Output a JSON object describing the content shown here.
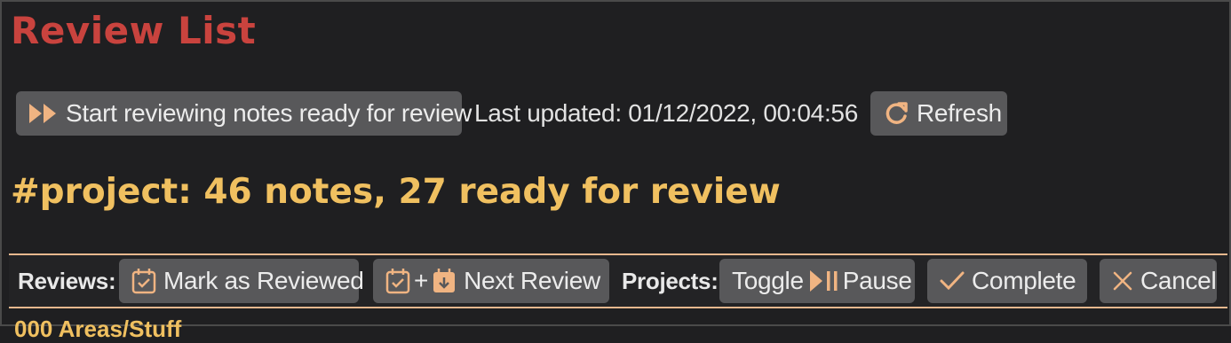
{
  "title": "Review List",
  "start_button": {
    "label": "Start reviewing notes ready for review",
    "icon": "fast-forward-icon"
  },
  "last_updated": "Last updated: 01/12/2022, 00:04:56",
  "refresh_button": {
    "label": "Refresh",
    "icon": "refresh-icon"
  },
  "heading": "#project: 46 notes, 27 ready for review",
  "toolbar": {
    "reviews_label": "Reviews:",
    "mark_reviewed": {
      "label": "Mark as Reviewed",
      "icon": "calendar-check-icon"
    },
    "next_review": {
      "plus": "+",
      "label": "Next Review",
      "icons": [
        "calendar-check-icon",
        "calendar-download-icon"
      ]
    },
    "projects_label": "Projects:",
    "toggle_pause": {
      "label_before": "Toggle",
      "label_after": "Pause",
      "icon": "play-pause-icon"
    },
    "complete": {
      "label": "Complete",
      "icon": "check-icon"
    },
    "cancel": {
      "label": "Cancel",
      "icon": "close-icon"
    }
  },
  "below_text": "000 Areas/Stuff",
  "colors": {
    "title": "#c9433e",
    "heading": "#f0c060",
    "icon": "#f0b482",
    "button_bg": "#58585a",
    "background": "#1f1f21"
  }
}
